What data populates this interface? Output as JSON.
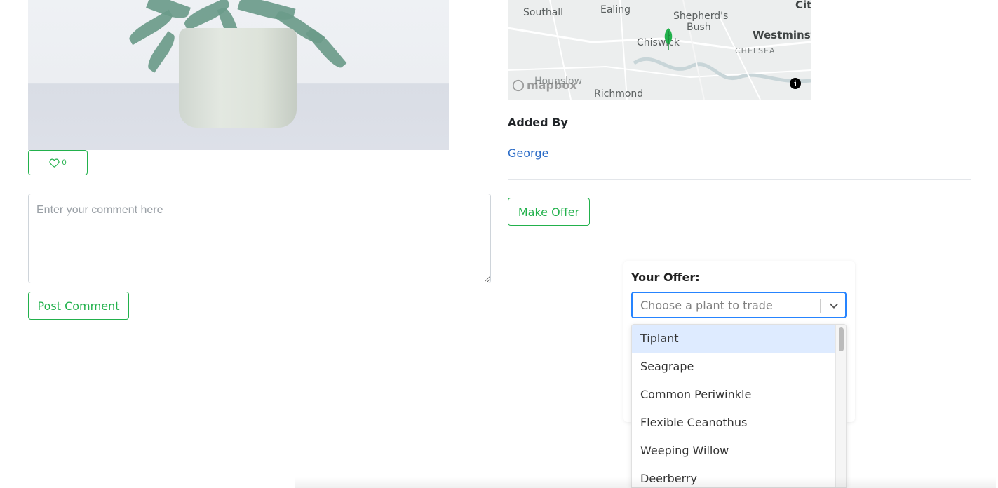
{
  "listing": {
    "like_count": "0",
    "comment_placeholder": "Enter your comment here",
    "post_comment_label": "Post Comment"
  },
  "map": {
    "labels": {
      "southall": "Southall",
      "ealing": "Ealing",
      "shepherds_bush_1": "Shepherd's",
      "shepherds_bush_2": "Bush",
      "city": "Cit",
      "westminster": "Westminste",
      "chiswick": "Chiswick",
      "chelsea": "CHELSEA",
      "hounslow": "Hounslow",
      "richmond": "Richmond"
    },
    "logo_text": "mapbox",
    "info_glyph": "i",
    "marker_color": "#22b14c"
  },
  "owner": {
    "added_by_label": "Added By",
    "name": "George"
  },
  "offer": {
    "make_offer_label": "Make Offer",
    "your_offer_label": "Your Offer:",
    "select_placeholder": "Choose a plant to trade",
    "options": [
      {
        "label": "Tiplant"
      },
      {
        "label": "Seagrape"
      },
      {
        "label": "Common Periwinkle"
      },
      {
        "label": "Flexible Ceanothus"
      },
      {
        "label": "Weeping Willow"
      },
      {
        "label": "Deerberry"
      }
    ]
  },
  "colors": {
    "accent": "#22b14c",
    "link": "#2a6bc7",
    "focus": "#2684ff",
    "option_highlight": "#deebff"
  }
}
